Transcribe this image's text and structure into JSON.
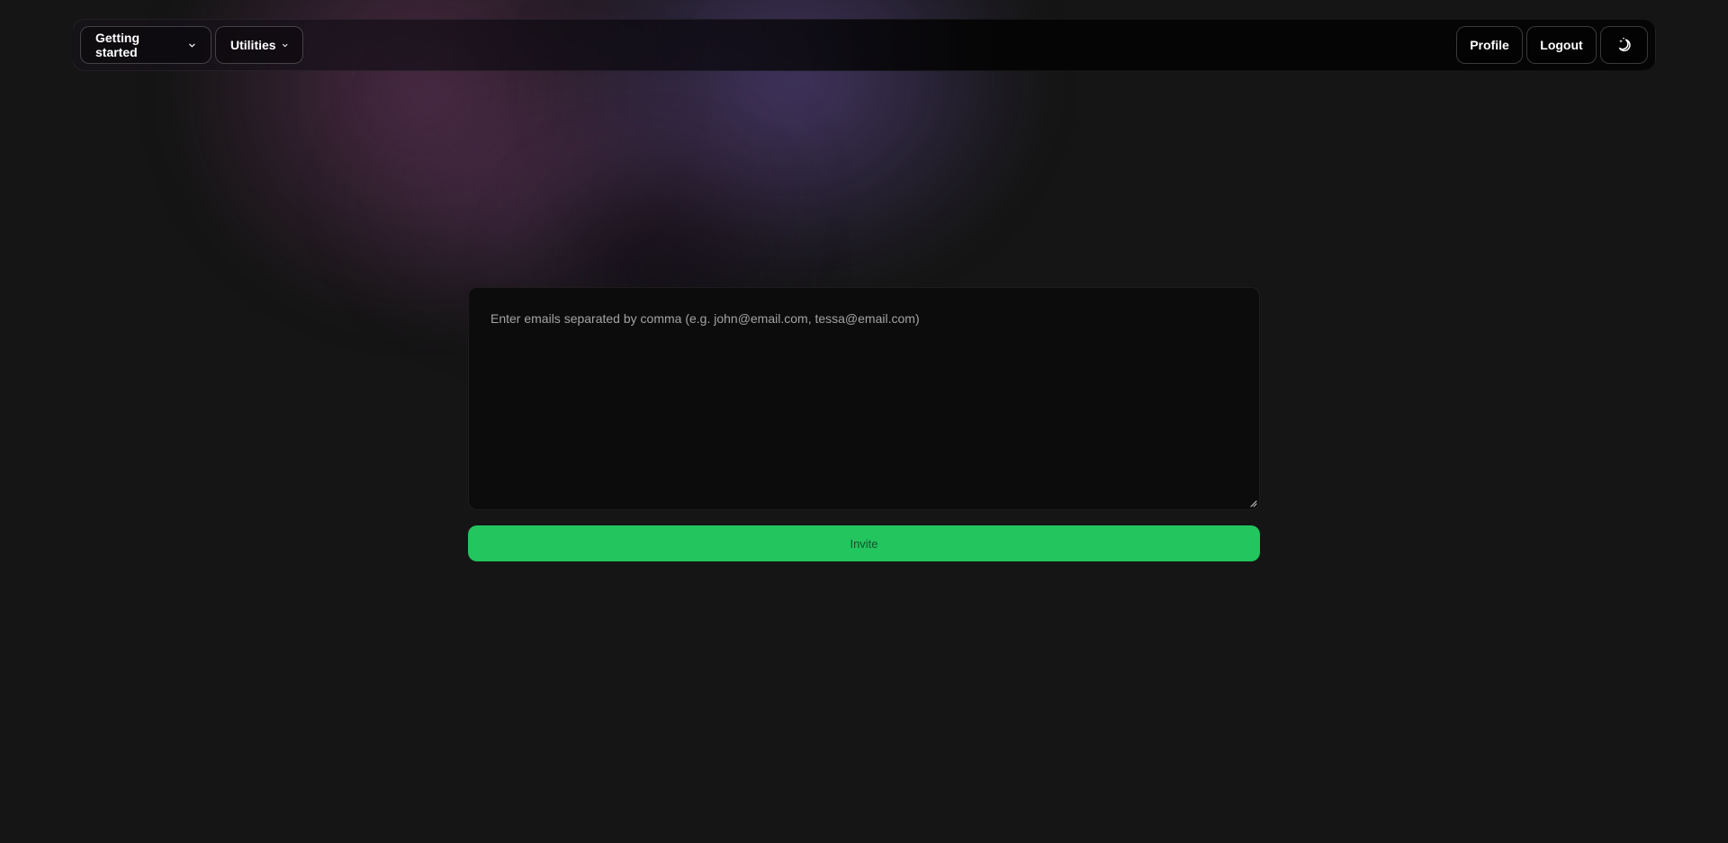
{
  "navbar": {
    "left_items": [
      {
        "label": "Getting started",
        "icon": "chevron-down-icon"
      },
      {
        "label": "Utilities",
        "icon": "chevron-down-icon"
      }
    ],
    "profile_label": "Profile",
    "logout_label": "Logout",
    "theme_icon": "moon-stars-icon"
  },
  "invite_form": {
    "emails_placeholder": "Enter emails separated by comma (e.g. john@email.com, tessa@email.com)",
    "emails_value": "",
    "invite_label": "Invite"
  },
  "colors": {
    "background": "#151515",
    "accent_green": "#22c55e",
    "glow_purple": "#6f4f9f",
    "glow_magenta": "#7a3c6e"
  }
}
